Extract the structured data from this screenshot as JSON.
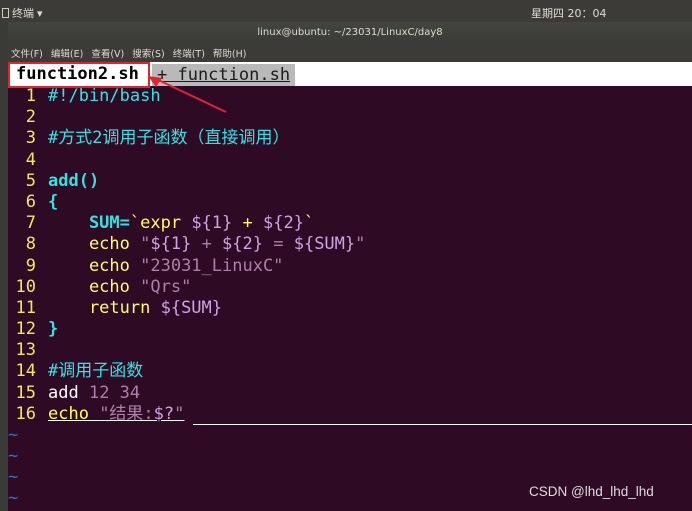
{
  "top_panel": {
    "app_name": "终端",
    "app_arrow": "▾",
    "clock": "星期四 20：04"
  },
  "window": {
    "title": "linux@ubuntu: ~/23031/LinuxC/day8"
  },
  "menubar": {
    "items": [
      "文件(F)",
      "编辑(E)",
      "查看(V)",
      "搜索(S)",
      "终端(T)",
      "帮助(H)"
    ]
  },
  "tabs": [
    {
      "label": "function2.sh",
      "active": true
    },
    {
      "label": " + function.sh ",
      "active": false
    }
  ],
  "code_lines": [
    {
      "n": "1",
      "text": "#!/bin/bash"
    },
    {
      "n": "2",
      "text": ""
    },
    {
      "n": "3",
      "text": "#方式2调用子函数（直接调用）"
    },
    {
      "n": "4",
      "text": ""
    },
    {
      "n": "5",
      "text": "add()"
    },
    {
      "n": "6",
      "text": "{"
    },
    {
      "n": "7",
      "p1": "    SUM=",
      "p2": "`expr ",
      "p3": "${1}",
      "p4": " + ",
      "p5": "${2}",
      "p6": "`"
    },
    {
      "n": "8",
      "p1": "    echo ",
      "p2": "\"",
      "p3": "${1}",
      "p4": " + ",
      "p5": "${2}",
      "p6": " = ",
      "p7": "${SUM}",
      "p8": "\""
    },
    {
      "n": "9",
      "p1": "    echo ",
      "p2": "\"23031_LinuxC\""
    },
    {
      "n": "10",
      "p1": "    echo ",
      "p2": "\"Qrs\""
    },
    {
      "n": "11",
      "p1": "    return ",
      "p2": "${SUM}"
    },
    {
      "n": "12",
      "text": "}"
    },
    {
      "n": "13",
      "text": ""
    },
    {
      "n": "14",
      "text": "#调用子函数"
    },
    {
      "n": "15",
      "p1": "add ",
      "p2": "12 34"
    },
    {
      "n": "16",
      "p1": "echo ",
      "p2": "\"结果:",
      "p3": "$?",
      "p4": "\""
    }
  ],
  "tilde_char": "~",
  "watermark": "CSDN @lhd_lhd_lhd",
  "colors": {
    "background": "#2f0a24",
    "line_number": "#f2e85a",
    "comment": "#34e2e2",
    "annotation": "#e0252e"
  }
}
